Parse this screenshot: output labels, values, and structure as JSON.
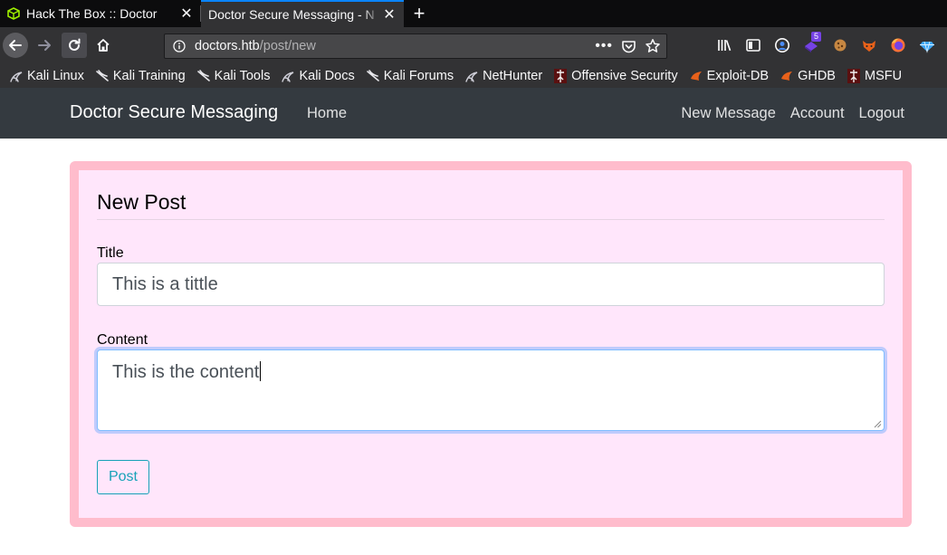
{
  "browser": {
    "tabs": [
      {
        "title": "Hack The Box :: Doctor",
        "active": false,
        "icon": "htb-cube-icon"
      },
      {
        "title": "Doctor Secure Messaging - N",
        "active": true,
        "icon": ""
      }
    ],
    "url": {
      "host": "doctors.htb",
      "path": "/post/new"
    },
    "bookmarks": [
      {
        "label": "Kali Linux",
        "icon": "kali-dragon-icon"
      },
      {
        "label": "Kali Training",
        "icon": "kali-dragon-icon"
      },
      {
        "label": "Kali Tools",
        "icon": "kali-dragon-icon"
      },
      {
        "label": "Kali Docs",
        "icon": "kali-dragon-icon"
      },
      {
        "label": "Kali Forums",
        "icon": "kali-dragon-icon"
      },
      {
        "label": "NetHunter",
        "icon": "kali-dragon-icon"
      },
      {
        "label": "Offensive Security",
        "icon": "offsec-icon"
      },
      {
        "label": "Exploit-DB",
        "icon": "exploitdb-icon"
      },
      {
        "label": "GHDB",
        "icon": "exploitdb-icon"
      },
      {
        "label": "MSFU",
        "icon": "offsec-icon"
      }
    ],
    "extension_badge": "5"
  },
  "site": {
    "brand": "Doctor Secure Messaging",
    "nav": {
      "home": "Home",
      "new_message": "New Message",
      "account": "Account",
      "logout": "Logout"
    }
  },
  "form": {
    "legend": "New Post",
    "title_label": "Title",
    "title_value": "This is a tittle",
    "content_label": "Content",
    "content_value": "This is the content",
    "submit_label": "Post"
  },
  "colors": {
    "navbar_bg": "#343a40",
    "card_bg": "#ffe6fb",
    "card_border": "#ffbccc",
    "button_accent": "#17a2b8",
    "firefox_accent": "#0a84ff"
  }
}
